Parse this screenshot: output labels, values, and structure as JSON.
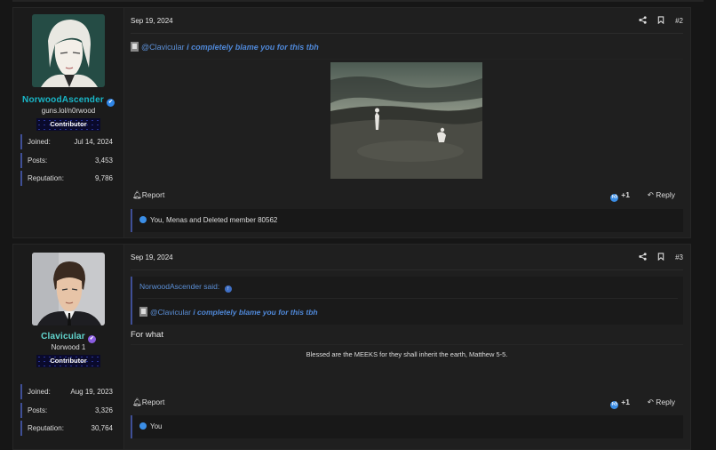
{
  "posts": [
    {
      "user": {
        "name": "NorwoodAscender",
        "subtitle": "guns.lol/n0rwood",
        "role": "Contributor",
        "joined_label": "Joined:",
        "joined": "Jul 14, 2024",
        "posts_label": "Posts:",
        "posts": "3,453",
        "rep_label": "Reputation:",
        "rep": "9,786",
        "name_color": "#19b7c8",
        "badge_color": "#2f86e8"
      },
      "date": "Sep 19, 2024",
      "number": "#2",
      "mention": "@Clavicular",
      "message": "i completely blame you for this tbh",
      "report": "Report",
      "reaction_count": "+1",
      "reply": "Reply",
      "reactions": "You, Menas and Deleted member 80562"
    },
    {
      "user": {
        "name": "Clavicular",
        "subtitle": "Norwood 1",
        "role": "Contributor",
        "joined_label": "Joined:",
        "joined": "Aug 19, 2023",
        "posts_label": "Posts:",
        "posts": "3,326",
        "rep_label": "Reputation:",
        "rep": "30,764",
        "name_color": "#62d6cf",
        "badge_color": "#8a5ce0"
      },
      "date": "Sep 19, 2024",
      "number": "#3",
      "quote_author": "NorwoodAscender said:",
      "quote_mention": "@Clavicular",
      "quote_message": "i completely blame you for this tbh",
      "text": "For what",
      "signature": "Blessed are the MEEKS for they shall inherit the earth, Matthew 5-5.",
      "report": "Report",
      "reaction_count": "+1",
      "reply": "Reply",
      "reactions": "You"
    }
  ],
  "icons": [
    "share-icon",
    "bookmark-icon",
    "bell-icon",
    "like-icon",
    "reply-arrow-icon",
    "verified-badge-icon",
    "quote-arrow-icon"
  ]
}
